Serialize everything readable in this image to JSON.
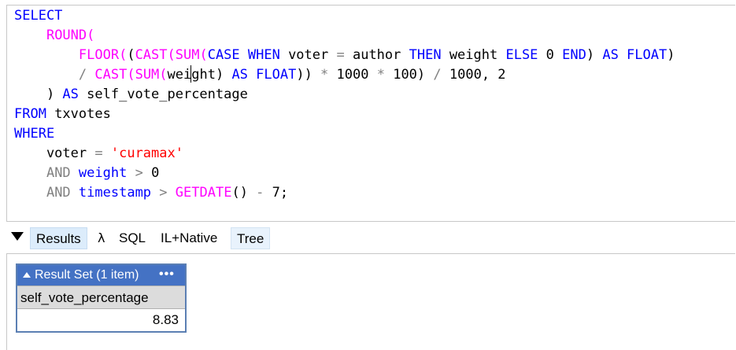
{
  "editor": {
    "lines": [
      [
        {
          "t": "SELECT",
          "c": "kw"
        }
      ],
      [
        {
          "t": "    "
        },
        {
          "t": "ROUND(",
          "c": "fn"
        }
      ],
      [
        {
          "t": "        "
        },
        {
          "t": "FLOOR(",
          "c": "fn"
        },
        {
          "t": "(",
          "c": ""
        },
        {
          "t": "CAST(",
          "c": "fn"
        },
        {
          "t": "SUM(",
          "c": "fn"
        },
        {
          "t": "CASE WHEN",
          "c": "kw"
        },
        {
          "t": " voter "
        },
        {
          "t": "=",
          "c": "op"
        },
        {
          "t": " author "
        },
        {
          "t": "THEN",
          "c": "kw"
        },
        {
          "t": " weight "
        },
        {
          "t": "ELSE",
          "c": "kw"
        },
        {
          "t": " 0 "
        },
        {
          "t": "END",
          "c": "kw"
        },
        {
          "t": ") "
        },
        {
          "t": "AS FLOAT",
          "c": "kw"
        },
        {
          "t": ")"
        }
      ],
      [
        {
          "t": "        "
        },
        {
          "t": "/",
          "c": "op"
        },
        {
          "t": " "
        },
        {
          "t": "CAST(",
          "c": "fn"
        },
        {
          "t": "SUM(",
          "c": "fn"
        },
        {
          "t": "wei"
        },
        {
          "t": "",
          "caret": true
        },
        {
          "t": "ght) "
        },
        {
          "t": "AS FLOAT",
          "c": "kw"
        },
        {
          "t": ")) "
        },
        {
          "t": "*",
          "c": "op"
        },
        {
          "t": " 1000 "
        },
        {
          "t": "*",
          "c": "op"
        },
        {
          "t": " 100) "
        },
        {
          "t": "/",
          "c": "op"
        },
        {
          "t": " 1000, 2"
        }
      ],
      [
        {
          "t": "    ) "
        },
        {
          "t": "AS",
          "c": "kw"
        },
        {
          "t": " self_vote_percentage"
        }
      ],
      [
        {
          "t": "FROM",
          "c": "kw"
        },
        {
          "t": " txvotes"
        }
      ],
      [
        {
          "t": "WHERE",
          "c": "kw"
        }
      ],
      [
        {
          "t": "    voter "
        },
        {
          "t": "=",
          "c": "op"
        },
        {
          "t": " "
        },
        {
          "t": "'curamax'",
          "c": "str"
        }
      ],
      [
        {
          "t": "    "
        },
        {
          "t": "AND",
          "c": "op"
        },
        {
          "t": " "
        },
        {
          "t": "weight",
          "c": "kw"
        },
        {
          "t": " "
        },
        {
          "t": ">",
          "c": "op"
        },
        {
          "t": " 0"
        }
      ],
      [
        {
          "t": "    "
        },
        {
          "t": "AND",
          "c": "op"
        },
        {
          "t": " "
        },
        {
          "t": "timestamp",
          "c": "kw"
        },
        {
          "t": " "
        },
        {
          "t": ">",
          "c": "op"
        },
        {
          "t": " "
        },
        {
          "t": "GETDATE",
          "c": "fn"
        },
        {
          "t": "() "
        },
        {
          "t": "-",
          "c": "op"
        },
        {
          "t": " 7;"
        }
      ]
    ]
  },
  "tabs": {
    "results": "Results",
    "lambda": "λ",
    "sql": "SQL",
    "il_native": "IL+Native",
    "tree": "Tree"
  },
  "result_set": {
    "title": "Result Set (1 item)",
    "more": "•••",
    "column": "self_vote_percentage",
    "value": "8.83"
  },
  "colors": {
    "keyword": "#0000ff",
    "function": "#ff00ff",
    "operator": "#808080",
    "string": "#ff0000",
    "result_header": "#4472c4"
  }
}
